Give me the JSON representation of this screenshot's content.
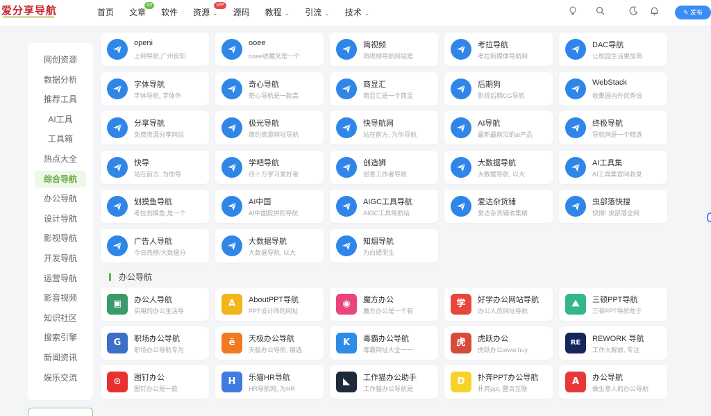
{
  "logo": {
    "text": "爱分享导航"
  },
  "nav": [
    {
      "label": "首页",
      "badge": null,
      "dropdown": false
    },
    {
      "label": "文章",
      "badge": "43",
      "badge_color": "#6cc04a",
      "dropdown": false
    },
    {
      "label": "软件",
      "badge": null,
      "dropdown": false
    },
    {
      "label": "资源",
      "badge": "VIP",
      "badge_color": "#e8474c",
      "dropdown": true
    },
    {
      "label": "源码",
      "badge": null,
      "dropdown": false
    },
    {
      "label": "教程",
      "badge": null,
      "dropdown": true
    },
    {
      "label": "引流",
      "badge": null,
      "dropdown": true
    },
    {
      "label": "技术",
      "badge": null,
      "dropdown": true
    }
  ],
  "header_icons": [
    "lightbulb-icon",
    "search-icon",
    "moon-icon",
    "bell-icon"
  ],
  "publish_button": {
    "label": "✎ 发布"
  },
  "sidebar": {
    "active_index": 6,
    "items": [
      "网创资源",
      "数据分析",
      "推荐工具",
      "AI工具",
      "工具箱",
      "热点大全",
      "综合导航",
      "办公导航",
      "设计导航",
      "影视导航",
      "开发导航",
      "运营导航",
      "影音视频",
      "知识社区",
      "搜索引擎",
      "新闻资讯",
      "娱乐交流"
    ]
  },
  "nav_sites": [
    {
      "title": "openi",
      "desc": "上网导航,广州良知"
    },
    {
      "title": "ooee",
      "desc": "ooee收藏夹是一个"
    },
    {
      "title": "简视频",
      "desc": "简视频导航网站是"
    },
    {
      "title": "考拉导航",
      "desc": "考拉新媒体导航网"
    },
    {
      "title": "DAC导航",
      "desc": "让校园生活更加简"
    },
    {
      "title": "字体导航",
      "desc": "字体导航, 字体作"
    },
    {
      "title": "奇心导航",
      "desc": "奇心导航是一款高"
    },
    {
      "title": "商显汇",
      "desc": "商显汇是一个商显"
    },
    {
      "title": "后期狗",
      "desc": "影视后期CG导航"
    },
    {
      "title": "WebStack",
      "desc": "收集国内外优秀设"
    },
    {
      "title": "分享导航",
      "desc": "免费资源分享网站"
    },
    {
      "title": "极光导航",
      "desc": "简约资源网址导航"
    },
    {
      "title": "快导航网",
      "desc": "站在前方, 为你导航"
    },
    {
      "title": "AI导航",
      "desc": "最新最前沿的ai产品"
    },
    {
      "title": "终极导航",
      "desc": "导航网是一个精选"
    },
    {
      "title": "快导",
      "desc": "站在前方, 为你导"
    },
    {
      "title": "学吧导航",
      "desc": "四十万学习爱好者"
    },
    {
      "title": "创造狮",
      "desc": "创意工作者导航"
    },
    {
      "title": "大数据导航",
      "desc": "大数据导航, 以大"
    },
    {
      "title": "AI工具集",
      "desc": "AI工具集官网收录"
    },
    {
      "title": "划摸鱼导航",
      "desc": "考拉划摸鱼,是一个"
    },
    {
      "title": "AI中国",
      "desc": "AI中国提供的导航"
    },
    {
      "title": "AIGC工具导航",
      "desc": "AIGC工具导航站"
    },
    {
      "title": "爱达杂货铺",
      "desc": "爱达杂货铺收集精"
    },
    {
      "title": "虫部落快搜",
      "desc": "快搜! 虫部落全网"
    },
    {
      "title": "广告人导航",
      "desc": "今日热榜/大数据分"
    },
    {
      "title": "大数据导航",
      "desc": "大数据导航, 以大"
    },
    {
      "title": "知烟导航",
      "desc": "为白嫖而生"
    }
  ],
  "office_section": {
    "title": "办公导航"
  },
  "office_sites": [
    {
      "title": "办公人导航",
      "desc": "实用的办公生活导",
      "icon": "monitor-icon",
      "color": "#3a9a6a",
      "glyph": "▣"
    },
    {
      "title": "AboutPPT导航",
      "desc": "PPT设计师的网址",
      "icon": "aboutppt-logo-icon",
      "color": "#f2b616",
      "glyph": "A"
    },
    {
      "title": "魔方办公",
      "desc": "魔方办公是一个有",
      "icon": "mofang-logo-icon",
      "color": "#e9457a",
      "glyph": "◉"
    },
    {
      "title": "好学办公网站导航",
      "desc": "办公人员网址导航",
      "icon": "xue-logo-icon",
      "color": "#e8463d",
      "glyph": "学"
    },
    {
      "title": "三顿PPT导航",
      "desc": "三顿PPT导航助于",
      "icon": "mountain-logo-icon",
      "color": "#34b887",
      "glyph": "⛰"
    },
    {
      "title": "职场办公导航",
      "desc": "职场办公导航专为",
      "icon": "zhichang-logo-icon",
      "color": "#3d6fc9",
      "glyph": "G"
    },
    {
      "title": "天极办公导航",
      "desc": "天极办公导航, 精选",
      "icon": "tianji-logo-icon",
      "color": "#f07a22",
      "glyph": "ё"
    },
    {
      "title": "毒霸办公导航",
      "desc": "毒霸网址大全一一",
      "icon": "duba-logo-icon",
      "color": "#2d8ce8",
      "glyph": "K"
    },
    {
      "title": "虎跃办公",
      "desc": "虎跃办公www.huy",
      "icon": "huyue-logo-icon",
      "color": "#d64c3a",
      "glyph": "虎"
    },
    {
      "title": "REWORK 导航",
      "desc": "工作大解放, 专注",
      "icon": "rework-logo-icon",
      "color": "#16265a",
      "glyph": "RE"
    },
    {
      "title": "图钉办公",
      "desc": "图钉办公是一款",
      "icon": "tuding-logo-icon",
      "color": "#e8312f",
      "glyph": "⊙"
    },
    {
      "title": "乐猫HR导航",
      "desc": "HR导航网, 为HR",
      "icon": "lemao-logo-icon",
      "color": "#3f7be0",
      "glyph": "H"
    },
    {
      "title": "工作猫办公助手",
      "desc": "工作猫办公导航是",
      "icon": "cat-logo-icon",
      "color": "#1e2a3a",
      "glyph": "◣"
    },
    {
      "title": "扑奔PPT办公导航",
      "desc": "扑奔ppt, 整合互联",
      "icon": "puben-logo-icon",
      "color": "#f6d22b",
      "glyph": "D"
    },
    {
      "title": "办公导航",
      "desc": "做生意人的办公导航",
      "icon": "bangong-logo-icon",
      "color": "#e63a3a",
      "glyph": "A"
    }
  ]
}
